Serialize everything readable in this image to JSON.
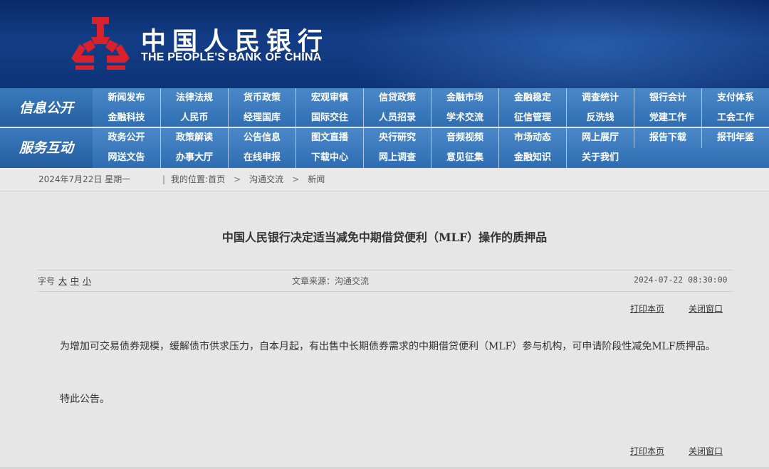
{
  "header": {
    "bank_name_cn": "中国人民银行",
    "bank_name_en": "THE PEOPLE'S BANK OF CHINA",
    "logo_icon": "pboc-logo-icon"
  },
  "nav": {
    "info": {
      "label": "信息公开",
      "items": [
        "新闻发布",
        "法律法规",
        "货币政策",
        "宏观审慎",
        "信贷政策",
        "金融市场",
        "金融稳定",
        "调查统计",
        "银行会计",
        "支付体系",
        "金融科技",
        "人民币",
        "经理国库",
        "国际交往",
        "人员招录",
        "学术交流",
        "征信管理",
        "反洗钱",
        "党建工作",
        "工会工作"
      ]
    },
    "service": {
      "label": "服务互动",
      "items": [
        "政务公开",
        "政策解读",
        "公告信息",
        "图文直播",
        "央行研究",
        "音频视频",
        "市场动态",
        "网上展厅",
        "报告下载",
        "报刊年鉴",
        "网送文告",
        "办事大厅",
        "在线申报",
        "下载中心",
        "网上调查",
        "意见征集",
        "金融知识",
        "关于我们"
      ]
    }
  },
  "breadcrumb": {
    "date": "2024年7月22日  星期一",
    "location_label": "我的位置:",
    "home": "首页",
    "level1": "沟通交流",
    "level2": "新闻"
  },
  "article": {
    "title": "中国人民银行决定适当减免中期借贷便利（MLF）操作的质押品",
    "font_size_label": "字号",
    "font_sizes": [
      "大",
      "中",
      "小"
    ],
    "source": "文章来源：沟通交流",
    "datetime": "2024-07-22  08:30:00",
    "print_label": "打印本页",
    "close_label": "关闭窗口",
    "paragraph1": "为增加可交易债券规模，缓解债市供求压力，自本月起，有出售中长期债券需求的中期借贷便利（MLF）参与机构，可申请阶段性减免MLF质押品。",
    "paragraph2": "特此公告。"
  },
  "colors": {
    "banner": "#123d86",
    "nav": "#3b7bbf",
    "logo_red": "#d8212a",
    "page_bg": "#e6e6e6"
  }
}
